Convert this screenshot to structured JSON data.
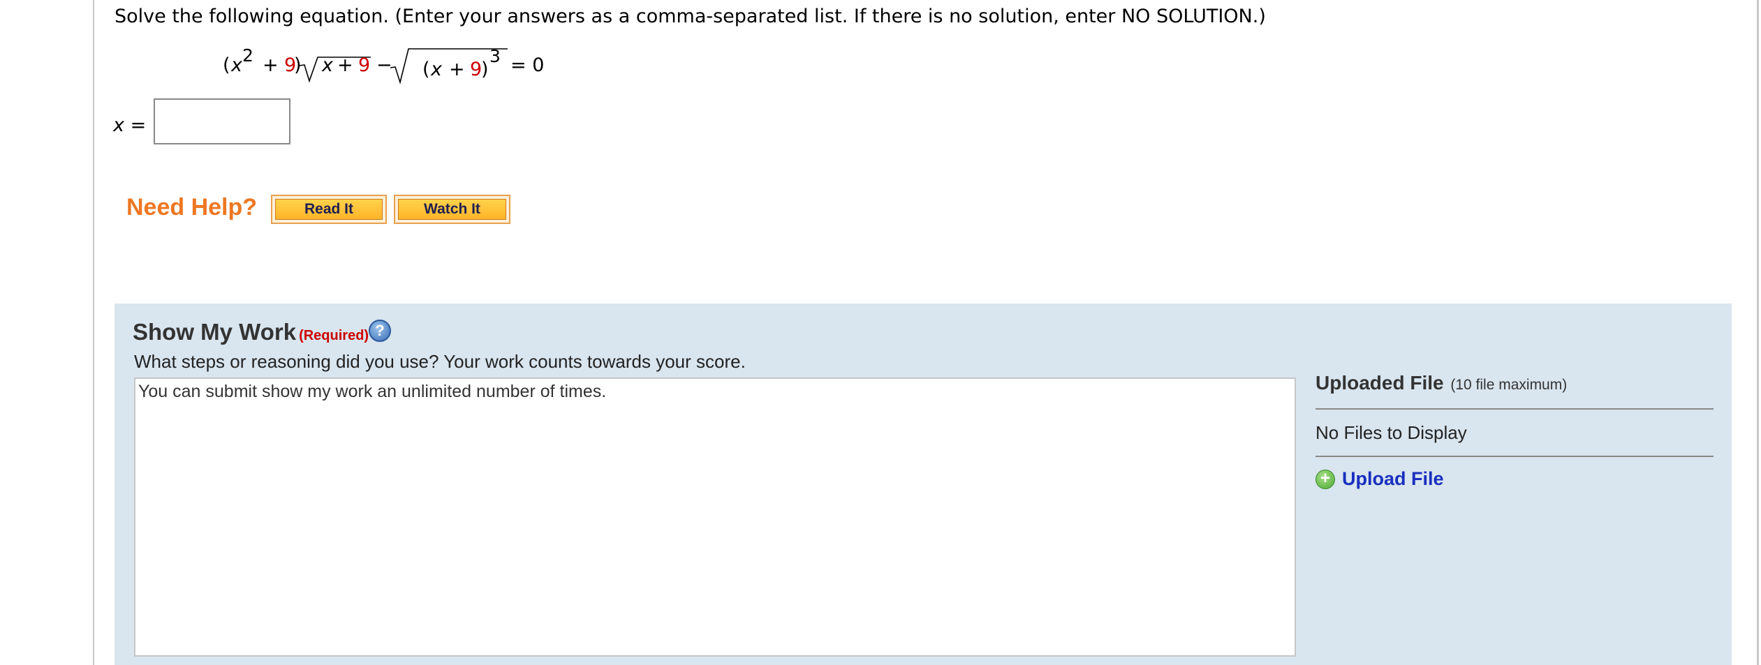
{
  "question": {
    "text": "Solve the following equation. (Enter your answers as a comma-separated list. If there is no solution, enter NO SOLUTION.)"
  },
  "equation": {
    "open_paren": "(",
    "var_x": "x",
    "exponent_2": "2",
    "plus": "+",
    "const_9": "9",
    "close_paren": ")",
    "radicand_var": "x",
    "radicand_plus": "+",
    "radicand_const": "9",
    "minus": "−",
    "radicand2_open": "(",
    "radicand2_var": "x",
    "radicand2_plus": "+",
    "radicand2_const": "9",
    "radicand2_close": ")",
    "exponent_3": "3",
    "equals_zero": "= 0",
    "highlight_color": "#cc0000"
  },
  "answer": {
    "label_var": "x",
    "label_eq": "=",
    "value": ""
  },
  "help": {
    "label": "Need Help?",
    "read_it": "Read It",
    "watch_it": "Watch It"
  },
  "show_my_work": {
    "title": "Show My Work",
    "required": "(Required)",
    "help_icon": "?",
    "subtitle": "What steps or reasoning did you use? Your work counts towards your score.",
    "textarea_placeholder": "You can submit show my work an unlimited number of times.",
    "textarea_value": ""
  },
  "uploads": {
    "title": "Uploaded File",
    "limit": "(10 file maximum)",
    "empty_text": "No Files to Display",
    "upload_icon": "+",
    "upload_label": "Upload File"
  },
  "colors": {
    "need_help": "#ee7722",
    "button_fill": "#ffc23a",
    "panel_bg": "#d9e5ef",
    "required": "#cc0000",
    "link": "#1a2fbf"
  }
}
